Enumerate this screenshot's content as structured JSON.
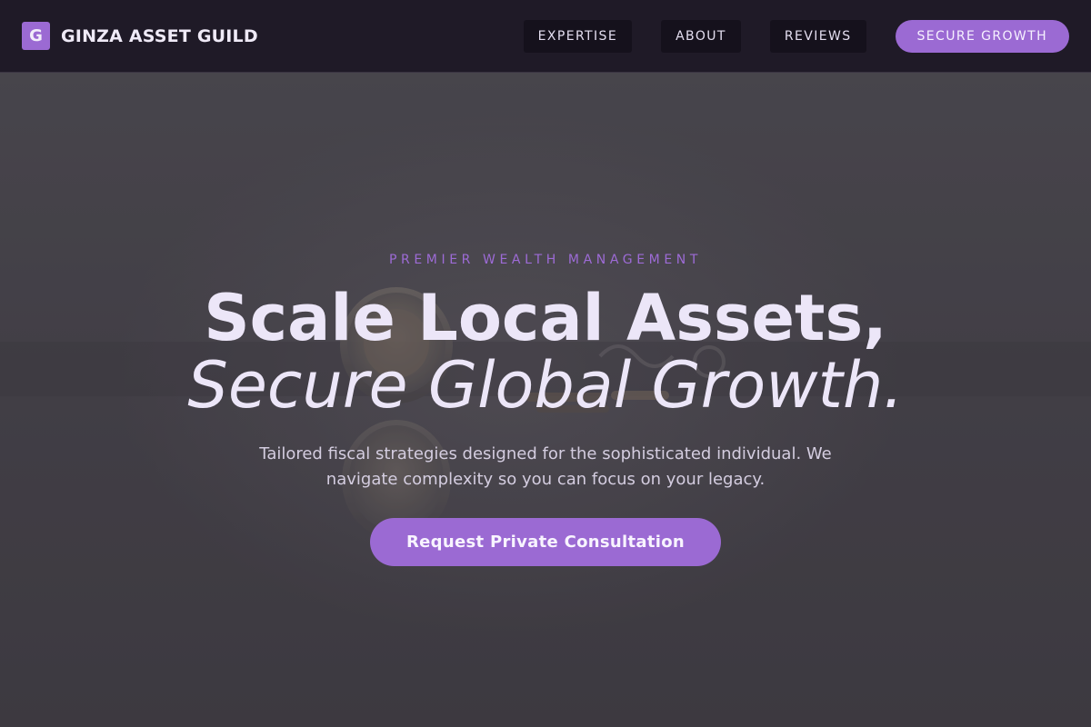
{
  "brand": {
    "mark": "G",
    "name": "GINZA ASSET GUILD"
  },
  "nav": {
    "links": [
      {
        "label": "EXPERTISE"
      },
      {
        "label": "ABOUT"
      },
      {
        "label": "REVIEWS"
      }
    ],
    "cta_label": "SECURE GROWTH"
  },
  "hero": {
    "eyebrow": "PREMIER WEALTH MANAGEMENT",
    "headline_line1": "Scale Local Assets,",
    "headline_line2": "Secure Global Growth.",
    "subcopy": "Tailored fiscal strategies designed for the sophisticated individual. We navigate complexity so you can focus on your legacy.",
    "cta_label": "Request Private Consultation",
    "background_image": "coins-photo"
  },
  "colors": {
    "accent": "#9b6ad3",
    "nav_background": "#1f1a27",
    "nav_link_background": "#15111c",
    "hero_text": "#ece6f8"
  }
}
